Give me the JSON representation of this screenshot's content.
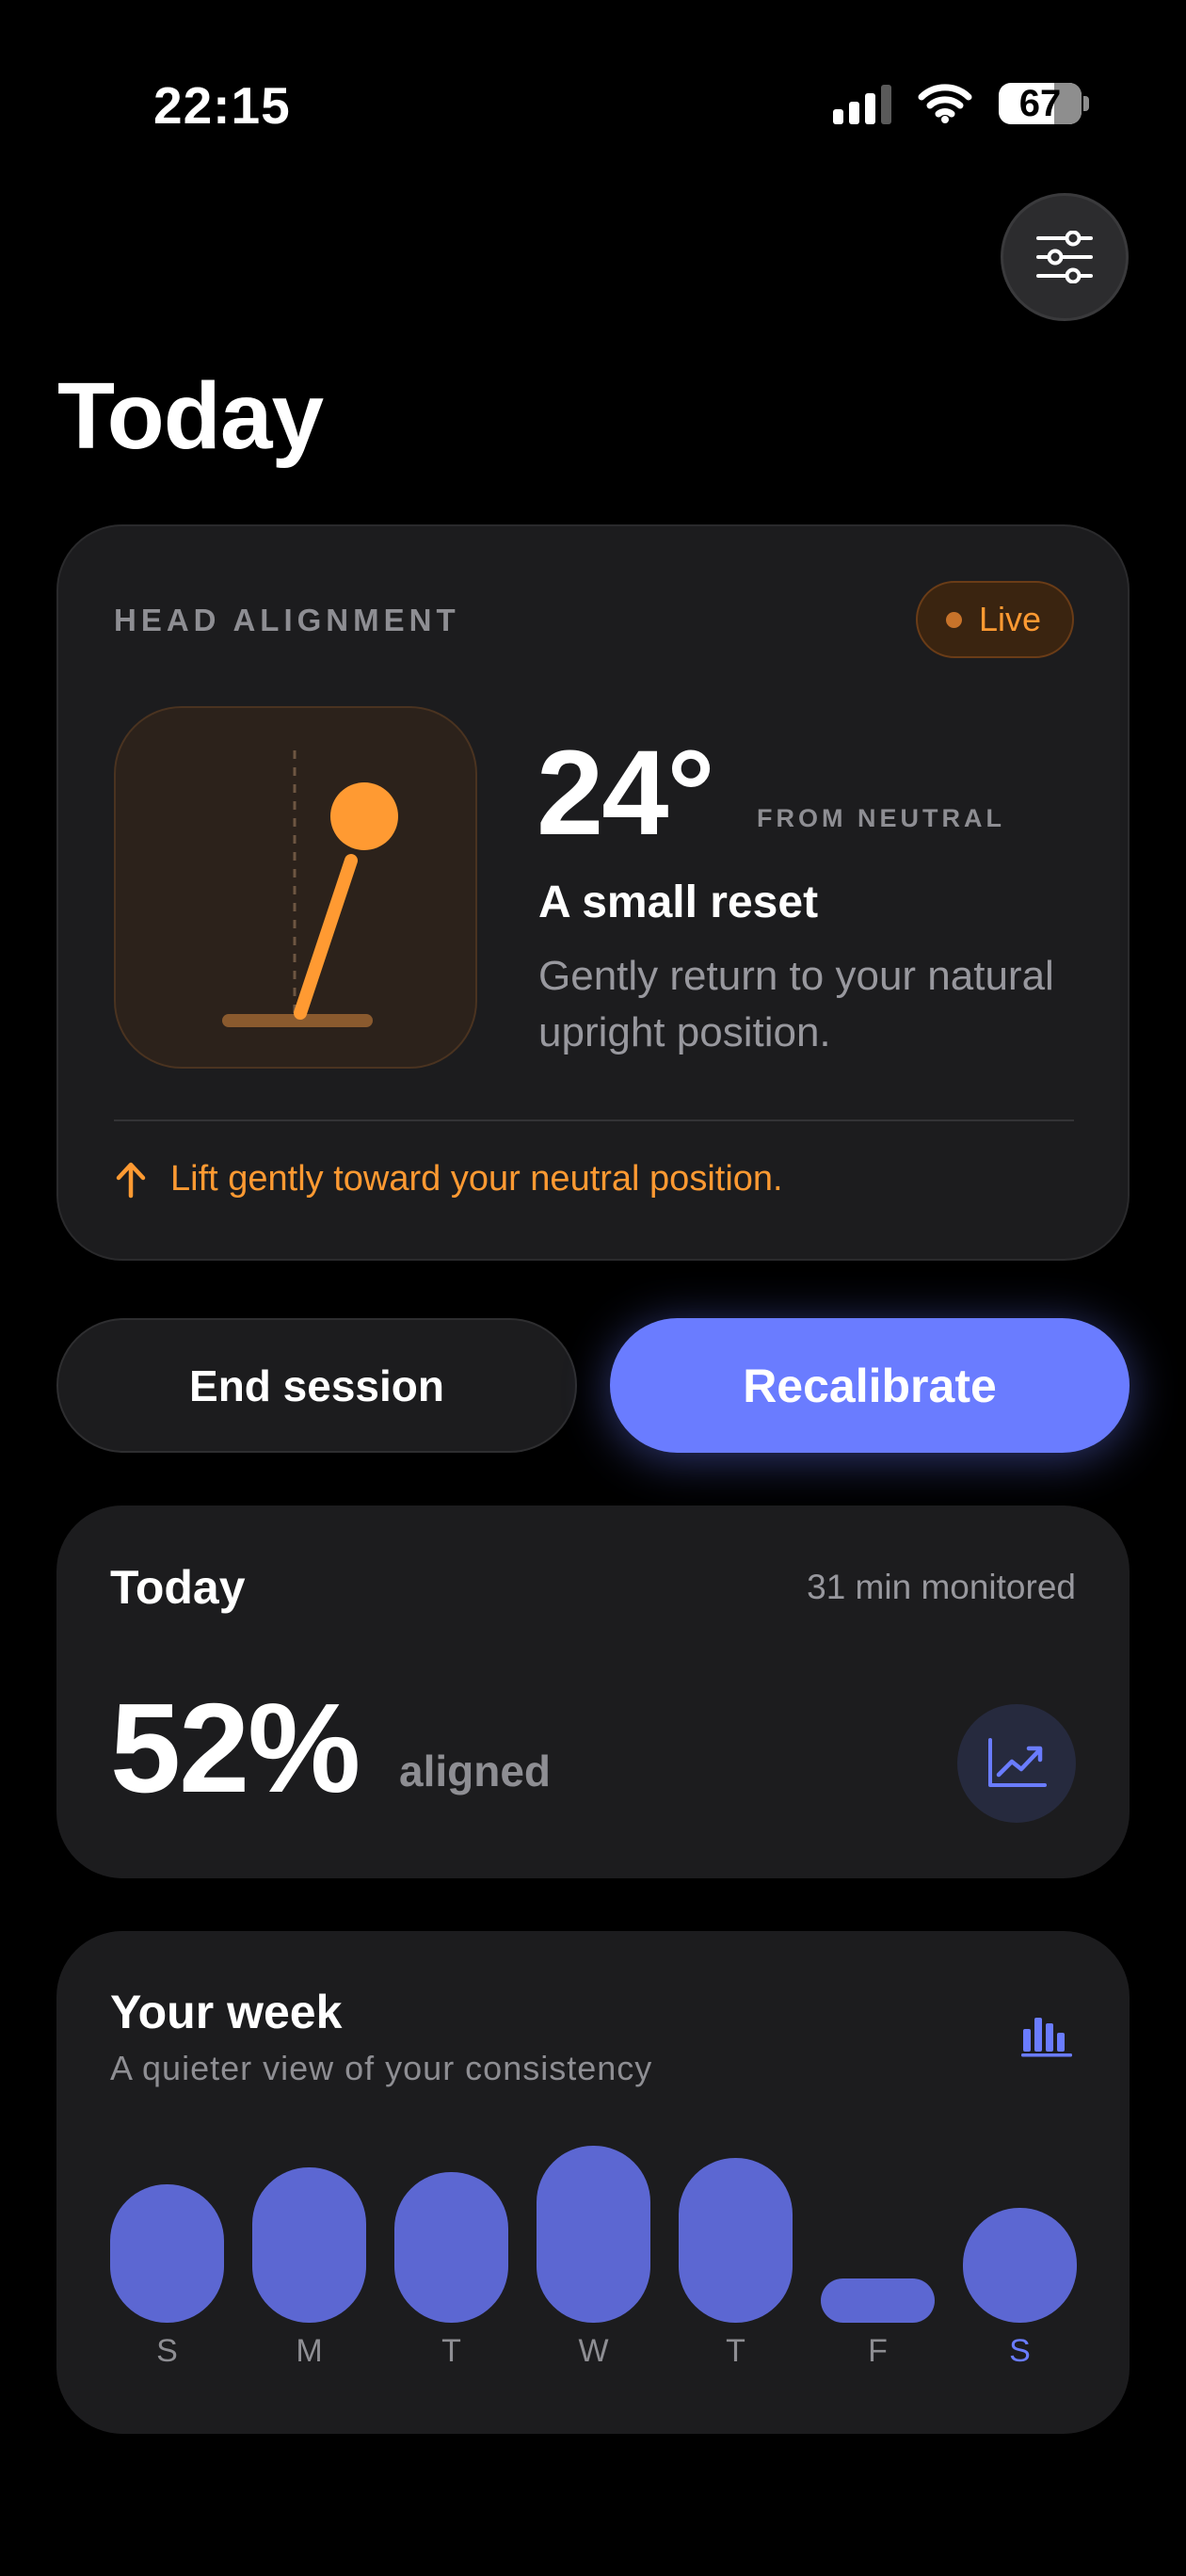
{
  "status_bar": {
    "time": "22:15",
    "battery": "67"
  },
  "header": {
    "title": "Today"
  },
  "alignment_card": {
    "eyebrow": "HEAD ALIGNMENT",
    "live_label": "Live",
    "degree": "24°",
    "from_neutral": "FROM NEUTRAL",
    "title": "A small reset",
    "description": "Gently return to your natural upright position.",
    "hint": "Lift gently toward your neutral position."
  },
  "actions": {
    "end_label": "End session",
    "recalibrate_label": "Recalibrate"
  },
  "today_card": {
    "label": "Today",
    "monitored": "31 min monitored",
    "percent": "52%",
    "aligned_label": "aligned"
  },
  "week_card": {
    "title": "Your week",
    "subtitle": "A quieter view of your consistency",
    "days": [
      {
        "label": "S",
        "level": 0.78
      },
      {
        "label": "M",
        "level": 0.88
      },
      {
        "label": "T",
        "level": 0.85
      },
      {
        "label": "W",
        "level": 1.0
      },
      {
        "label": "T",
        "level": 0.93
      },
      {
        "label": "F",
        "level": 0.25
      },
      {
        "label": "S",
        "level": 0.65,
        "today": true
      }
    ]
  },
  "colors": {
    "accent": "#6a7cff",
    "warning": "#ff9a32",
    "bar": "#5c67d2",
    "card": "#1c1c1e"
  }
}
